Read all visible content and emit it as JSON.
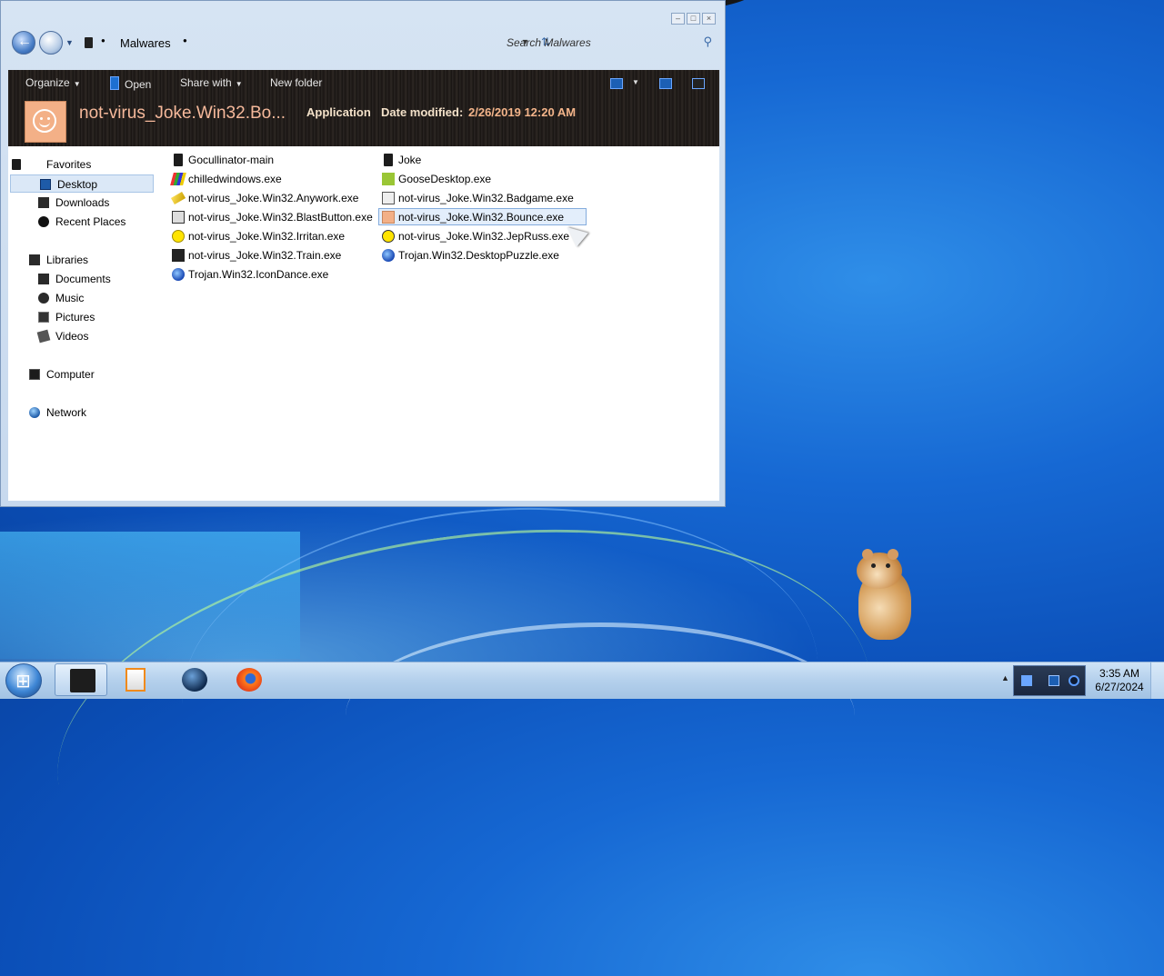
{
  "explorer": {
    "address": {
      "crumb": "Malwares"
    },
    "search": {
      "placeholder": "Search Malwares"
    },
    "toolbar": {
      "organize": "Organize",
      "open": "Open",
      "share_with": "Share with",
      "new_folder": "New folder"
    },
    "details": {
      "name": "not-virus_Joke.Win32.Bo...",
      "type": "Application",
      "date_label": "Date modified:",
      "date_value": "2/26/2019 12:20 AM"
    },
    "nav": {
      "favorites": "Favorites",
      "desktop": "Desktop",
      "downloads": "Downloads",
      "recent_places": "Recent Places",
      "libraries": "Libraries",
      "documents": "Documents",
      "music": "Music",
      "pictures": "Pictures",
      "videos": "Videos",
      "computer": "Computer",
      "network": "Network"
    },
    "files_col1": [
      {
        "name": "Gocullinator-main",
        "icon": "folder-icon"
      },
      {
        "name": "chilledwindows.exe",
        "icon": "colorful-app-icon"
      },
      {
        "name": "not-virus_Joke.Win32.Anywork.exe",
        "icon": "pencil-icon"
      },
      {
        "name": "not-virus_Joke.Win32.BlastButton.exe",
        "icon": "window-app-icon"
      },
      {
        "name": "not-virus_Joke.Win32.Irritan.exe",
        "icon": "smiley-icon"
      },
      {
        "name": "not-virus_Joke.Win32.Train.exe",
        "icon": "train-app-icon"
      },
      {
        "name": "Trojan.Win32.IconDance.exe",
        "icon": "globe-app-icon"
      }
    ],
    "files_col2": [
      {
        "name": "Joke",
        "icon": "folder-icon"
      },
      {
        "name": "GooseDesktop.exe",
        "icon": "goose-app-icon"
      },
      {
        "name": "not-virus_Joke.Win32.Badgame.exe",
        "icon": "game-app-icon"
      },
      {
        "name": "not-virus_Joke.Win32.Bounce.exe",
        "icon": "bounce-smiley-icon",
        "selected": true
      },
      {
        "name": "not-virus_Joke.Win32.JepRuss.exe",
        "icon": "smiley-icon"
      },
      {
        "name": "Trojan.Win32.DesktopPuzzle.exe",
        "icon": "globe-app-icon"
      }
    ]
  },
  "taskbar": {
    "time": "3:35 AM",
    "date": "6/27/2024",
    "pinned": [
      "start-button",
      "explorer-icon",
      "media-player-icon",
      "globe-browser-icon",
      "firefox-icon"
    ]
  },
  "colors": {
    "desktop_blue": "#1668d3",
    "banner_dark": "#1a1614",
    "banner_name": "#f6b99b",
    "selection": "#e3eefb"
  }
}
